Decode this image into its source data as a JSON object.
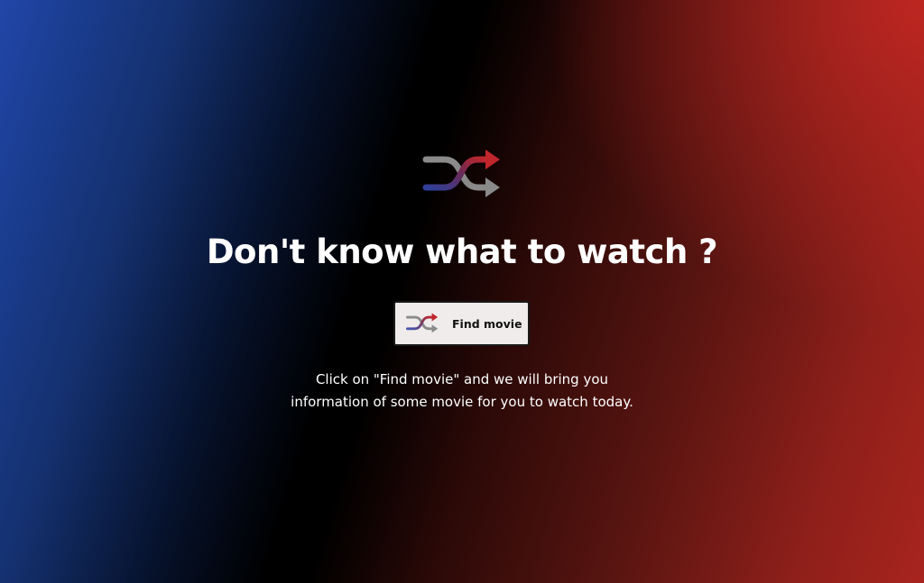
{
  "hero": {
    "icon": "shuffle-icon",
    "headline": "Don't know what to watch ?"
  },
  "action": {
    "button_icon": "shuffle-icon",
    "button_label": "Find movie"
  },
  "description": {
    "text": "Click on \"Find movie\" and we will bring you information of some movie for you to watch today."
  },
  "colors": {
    "gradient_left": "#2046a8",
    "gradient_middle": "#000000",
    "gradient_right": "#b8271f",
    "button_background": "#efeceb",
    "icon_blue": "#3a4aa5",
    "icon_red": "#b8262c",
    "icon_gray": "#8a8a8a"
  }
}
